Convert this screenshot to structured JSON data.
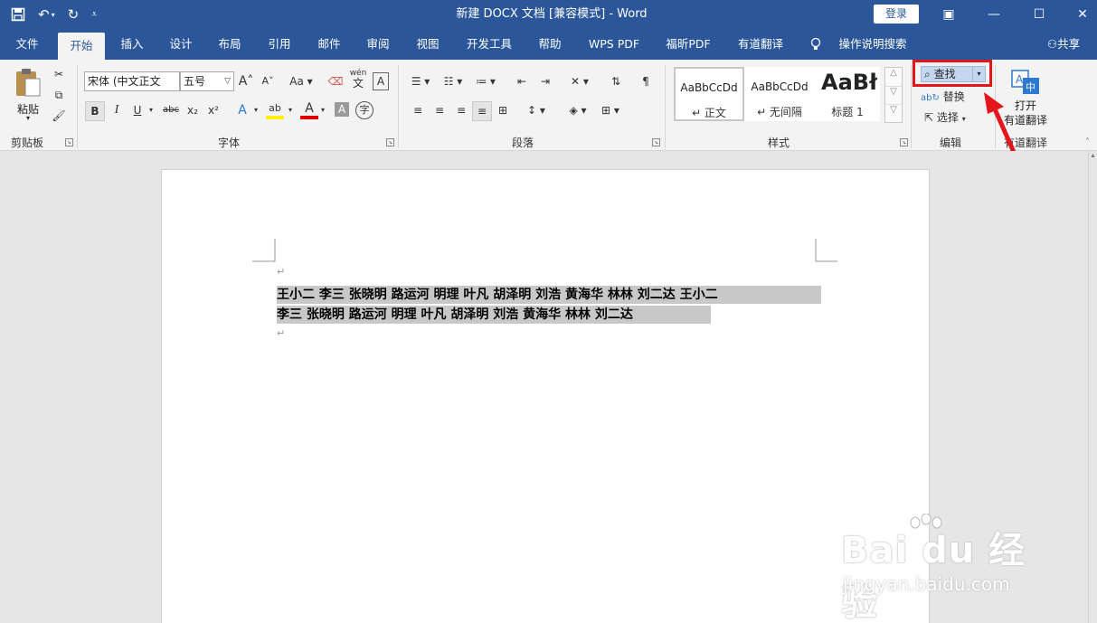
{
  "window": {
    "title": "新建 DOCX 文档 [兼容模式]  -  Word",
    "login_label": "登录",
    "controls": {
      "ribbon_display": "▣",
      "minimize": "—",
      "maximize": "☐",
      "close": "✕"
    }
  },
  "tabs": [
    {
      "label": "文件"
    },
    {
      "label": "开始"
    },
    {
      "label": "插入"
    },
    {
      "label": "设计"
    },
    {
      "label": "布局"
    },
    {
      "label": "引用"
    },
    {
      "label": "邮件"
    },
    {
      "label": "审阅"
    },
    {
      "label": "视图"
    },
    {
      "label": "开发工具"
    },
    {
      "label": "帮助"
    },
    {
      "label": "WPS PDF"
    },
    {
      "label": "福昕PDF"
    },
    {
      "label": "有道翻译"
    }
  ],
  "active_tab": "开始",
  "tell_me": "操作说明搜索",
  "share": "共享",
  "clipboard": {
    "paste_label": "粘贴",
    "group_label": "剪贴板"
  },
  "font": {
    "font_name": "宋体 (中文正文",
    "font_size": "五号",
    "group_label": "字体",
    "grow": "A",
    "shrink": "A",
    "case": "Aa",
    "phonetic_top": "wén",
    "phonetic_bottom": "文",
    "border": "A",
    "bold": "B",
    "italic": "I",
    "underline": "U",
    "strike": "abc",
    "subscript": "x₂",
    "superscript": "x²",
    "effects": "A",
    "highlight": "ab",
    "color": "A",
    "shade": "A",
    "enclose": "字"
  },
  "paragraph": {
    "group_label": "段落"
  },
  "styles": {
    "group_label": "样式",
    "items": [
      {
        "preview": "AaBbCcDd",
        "name": "↵ 正文"
      },
      {
        "preview": "AaBbCcDd",
        "name": "↵ 无间隔"
      },
      {
        "preview": "AaBł",
        "name": "标题 1"
      }
    ]
  },
  "editing": {
    "find": "查找",
    "replace": "替换",
    "select": "选择",
    "group_label": "编辑"
  },
  "youdao": {
    "line1": "打开",
    "line2": "有道翻译",
    "group_label": "有道翻译"
  },
  "document": {
    "line1": "王小二  李三  张晓明    路运河    明理  叶凡  胡泽明  刘浩    黄海华  林林  刘二达  王小二",
    "line2": "李三  张晓明    路运河    明理  叶凡  胡泽明  刘浩    黄海华  林林  刘二达",
    "para_mark": "↵"
  },
  "watermark": {
    "brand": "Bai du 经验",
    "url": "jingyan.baidu.com"
  }
}
